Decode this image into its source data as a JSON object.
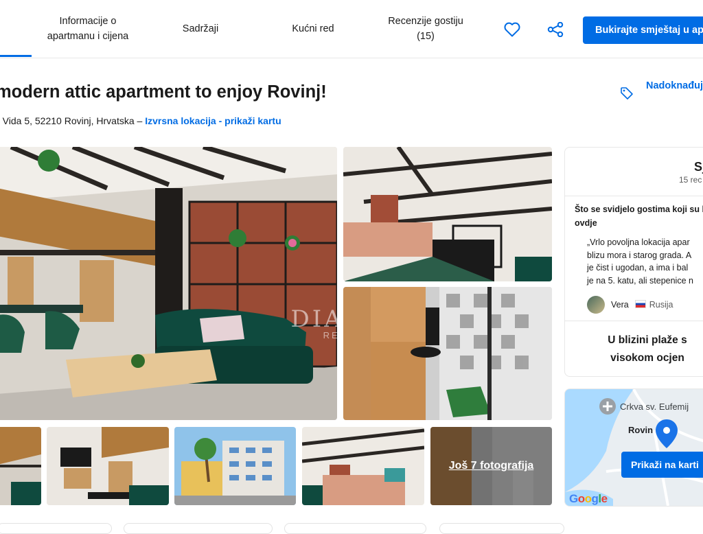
{
  "nav": {
    "tabs": [
      {
        "label_line1": "Informacije o",
        "label_line2": "apartmanu i cijena"
      },
      {
        "label": "Sadržaji"
      },
      {
        "label": "Kućni red"
      },
      {
        "label_line1": "Recenzije gostiju",
        "label_line2": "(15)"
      }
    ],
    "favorite_icon": "heart-icon",
    "share_icon": "share-icon",
    "book_label": "Bukirajte smještaj u ap"
  },
  "property": {
    "title": "modern attic apartment to enjoy Rovinj!",
    "address": "g Vida 5, 52210 Rovinj, Hrvatska –",
    "location_link": "Izvrsna lokacija - prikaži kartu",
    "price_match": "Nadoknađuj",
    "price_match_icon": "tag-icon"
  },
  "gallery": {
    "watermark_main": "DIAMOND",
    "watermark_sub": "REAL ESTATE",
    "more_photos": "Još 7 fotografija"
  },
  "reviews": {
    "score_word": "Sj",
    "count": "15 rec",
    "liked_heading_line1": "Što se svidjelo gostima koji su b",
    "liked_heading_line2": "ovdje",
    "quote_lines": [
      "„Vrlo povoljna lokacija apar",
      "blizu mora i starog grada. A",
      "je čist i ugodan, a ima i bal",
      "je na 5. katu, ali stepenice n"
    ],
    "reviewer_name": "Vera",
    "reviewer_country": "Rusija",
    "beach_line1": "U blizini plaže s",
    "beach_line2": "visokom ocjen"
  },
  "map": {
    "poi_label": "Crkva sv. Eufemij",
    "town_label": "Rovin",
    "button_label": "Prikaži na karti",
    "attribution": "Google"
  },
  "colors": {
    "brand_blue": "#006ce4",
    "text": "#1a1a1a",
    "muted": "#595959",
    "border": "#e7e7e7"
  }
}
